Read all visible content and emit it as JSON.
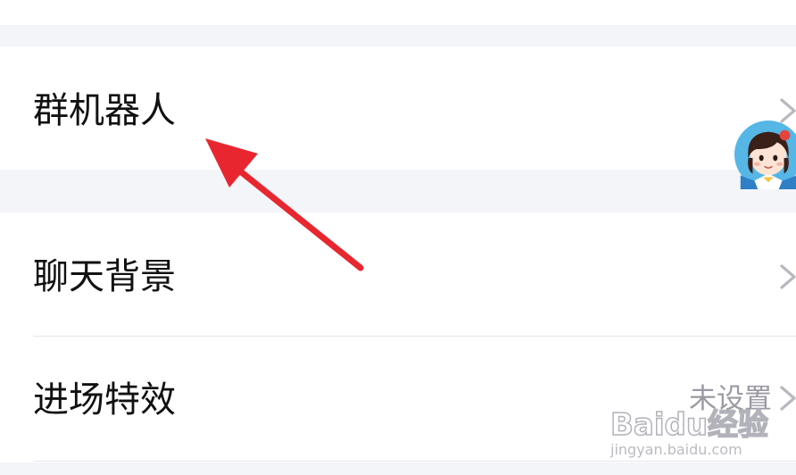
{
  "settings": {
    "rows": [
      {
        "label": "群机器人",
        "chevron_icon": "chevron-right-icon",
        "avatar_icon": "cartoon-girl-avatar"
      },
      {
        "label": "聊天背景",
        "chevron_icon": "chevron-right-icon"
      },
      {
        "label": "进场特效",
        "value": "未设置",
        "chevron_icon": "chevron-right-icon"
      }
    ]
  },
  "annotation": {
    "color": "#e8262f",
    "icon": "red-arrow-icon"
  },
  "watermark": {
    "brand": "Baidu经验",
    "url": "jingyan.baidu.com"
  },
  "colors": {
    "background": "#f4f5f9",
    "row": "#ffffff",
    "label": "#111111",
    "value": "#9a9aa3",
    "chevron": "#b8b8bf"
  }
}
